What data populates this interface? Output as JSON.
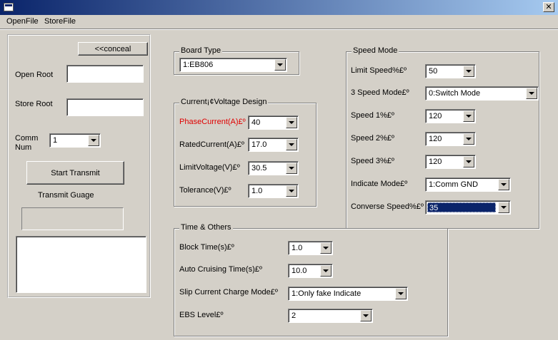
{
  "titlebar": {
    "close_glyph": "✕"
  },
  "menu": {
    "items": [
      "OpenFile",
      "StoreFile"
    ]
  },
  "left_panel": {
    "conceal_button": "<<conceal",
    "open_root_label": "Open Root",
    "store_root_label": "Store Root",
    "comm_num_label_1": "Comm",
    "comm_num_label_2": "Num",
    "comm_num_value": "1",
    "start_transmit_button": "Start Transmit",
    "transmit_guage_label": "Transmit Guage"
  },
  "board_type": {
    "title": "Board Type",
    "value": "1:EB806"
  },
  "current_voltage": {
    "title": "Current¡¢Voltage Design",
    "rows": [
      {
        "label": "PhaseCurrent(A)£º",
        "value": "40"
      },
      {
        "label": "RatedCurrent(A)£º",
        "value": "17.0"
      },
      {
        "label": "LimitVoltage(V)£º",
        "value": "30.5"
      },
      {
        "label": "Tolerance(V)£º",
        "value": "1.0"
      }
    ]
  },
  "speed_mode": {
    "title": "Speed Mode",
    "rows": [
      {
        "label": "Limit Speed%£º",
        "value": "50"
      },
      {
        "label": "3 Speed Mode£º",
        "value": "0:Switch Mode"
      },
      {
        "label": "Speed 1%£º",
        "value": "120"
      },
      {
        "label": "Speed 2%£º",
        "value": "120"
      },
      {
        "label": "Speed 3%£º",
        "value": "120"
      },
      {
        "label": "Indicate Mode£º",
        "value": "1:Comm GND"
      },
      {
        "label": "Converse Speed%£º",
        "value": "35"
      }
    ]
  },
  "time_others": {
    "title": "Time & Others",
    "rows": [
      {
        "label": "Block Time(s)£º",
        "value": "1.0"
      },
      {
        "label": "Auto Cruising Time(s)£º",
        "value": "10.0"
      },
      {
        "label": "Slip Current Charge Mode£º",
        "value": "1:Only fake Indicate"
      },
      {
        "label": "EBS Level£º",
        "value": "2"
      }
    ]
  },
  "colors": {
    "title_start": "#0a246a",
    "title_end": "#a6caf0",
    "face": "#d4d0c8",
    "highlight_label": "#e00000"
  }
}
